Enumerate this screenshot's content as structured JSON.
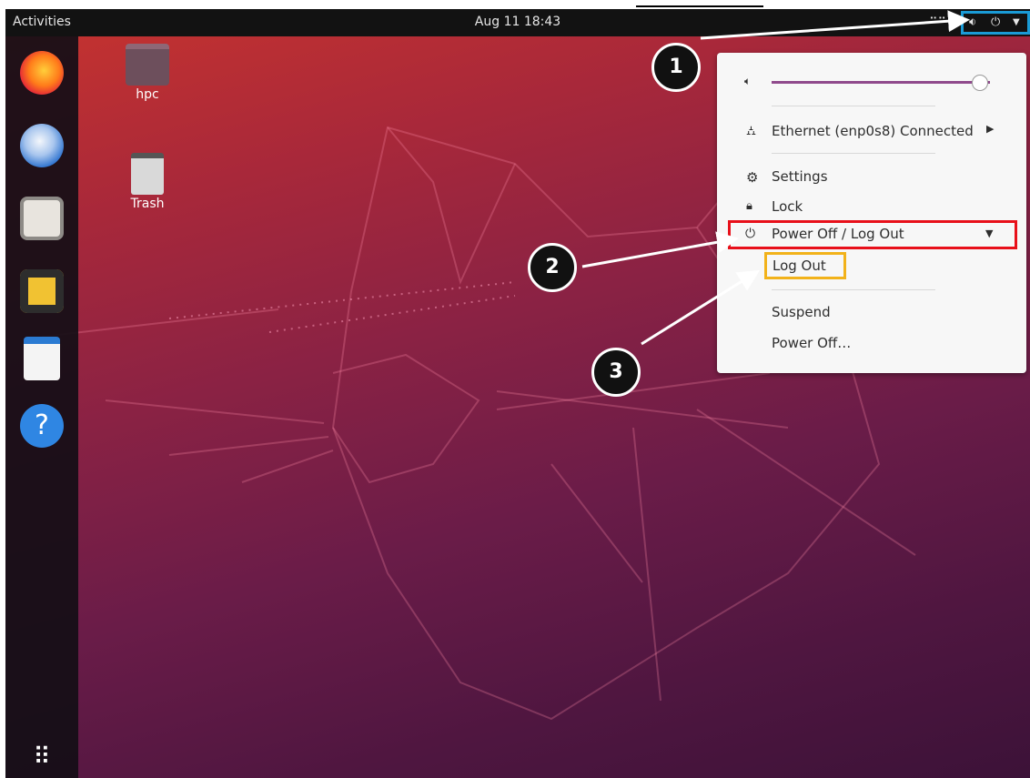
{
  "topbar": {
    "activities": "Activities",
    "clock": "Aug 11  18:43"
  },
  "desktop_items": [
    {
      "label": "hpc"
    },
    {
      "label": "Trash"
    }
  ],
  "dock": {
    "apps": [
      "firefox-icon",
      "thunderbird-icon",
      "files-icon",
      "rhythmbox-icon",
      "libreoffice-writer-icon",
      "help-icon",
      "app-grid-icon"
    ]
  },
  "menu": {
    "ethernet": "Ethernet (enp0s8) Connected",
    "settings": "Settings",
    "lock": "Lock",
    "power_off_logout": "Power Off / Log Out",
    "log_out": "Log Out",
    "suspend": "Suspend",
    "power_off": "Power Off…",
    "volume_level": 0.95
  },
  "callouts": [
    "1",
    "2",
    "3"
  ],
  "colors": {
    "accent_purple": "#8f4a8c",
    "highlight_red": "#e8101a",
    "highlight_yellow": "#f2b21a",
    "highlight_blue": "#1a9bd6"
  }
}
